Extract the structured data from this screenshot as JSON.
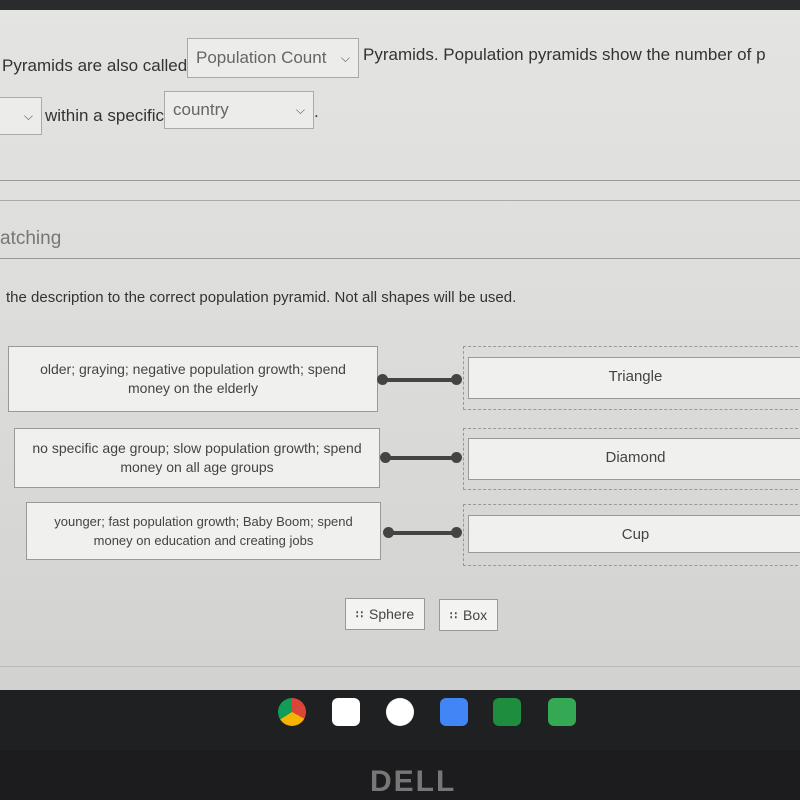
{
  "fill_in": {
    "line1_prefix": "Pyramids are also called",
    "select1_value": "Population Count",
    "line1_suffix": "Pyramids.  Population pyramids show the number of p",
    "line2_text": "within a specific",
    "select3_value": "country",
    "line2_end": "."
  },
  "section": {
    "title": "atching",
    "instructions": "the description to the correct population pyramid.  Not all shapes will be used."
  },
  "matches": [
    {
      "description": "older; graying; negative population growth; spend money on the elderly",
      "answer": "Triangle"
    },
    {
      "description": "no specific age group; slow population growth; spend money on all age groups",
      "answer": "Diamond"
    },
    {
      "description": "younger; fast population growth; Baby Boom; spend money on education and creating jobs",
      "answer": "Cup"
    }
  ],
  "unused_options": [
    "Sphere",
    "Box"
  ],
  "shelf_apps": [
    "chrome-icon",
    "gmail-icon",
    "drive-icon",
    "docs-icon",
    "classroom-icon",
    "play-store-icon"
  ],
  "bezel_logo": "DELL"
}
